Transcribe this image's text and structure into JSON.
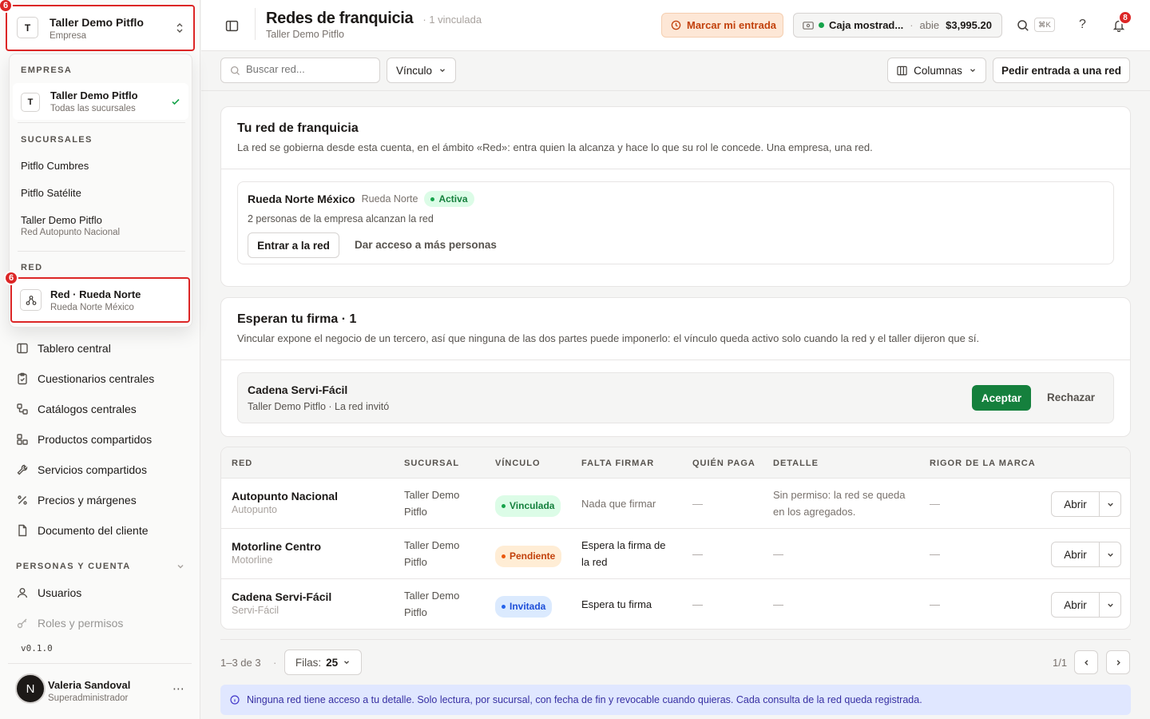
{
  "org_switcher": {
    "initial": "T",
    "name": "Taller Demo Pitflo",
    "subtitle": "Empresa",
    "badge": "6"
  },
  "dropdown": {
    "empresa_label": "EMPRESA",
    "empresa": {
      "initial": "T",
      "name": "Taller Demo Pitflo",
      "subtitle": "Todas las sucursales"
    },
    "sucursales_label": "SUCURSALES",
    "sucursales": [
      {
        "name": "Pitflo Cumbres",
        "subtitle": ""
      },
      {
        "name": "Pitflo Satélite",
        "subtitle": ""
      },
      {
        "name": "Taller Demo Pitflo",
        "subtitle": "Red Autopunto Nacional"
      }
    ],
    "red_label": "RED",
    "red": {
      "name": "Red · Rueda Norte",
      "subtitle": "Rueda Norte México",
      "badge": "6"
    }
  },
  "nav": {
    "items": [
      {
        "label": "Tablero central",
        "icon": "layout-icon"
      },
      {
        "label": "Cuestionarios centrales",
        "icon": "clipboard-icon"
      },
      {
        "label": "Catálogos centrales",
        "icon": "catalog-icon"
      },
      {
        "label": "Productos compartidos",
        "icon": "boxes-icon"
      },
      {
        "label": "Servicios compartidos",
        "icon": "wrench-icon"
      },
      {
        "label": "Precios y márgenes",
        "icon": "percent-icon"
      },
      {
        "label": "Documento del cliente",
        "icon": "document-icon"
      }
    ],
    "section_label": "PERSONAS Y CUENTA",
    "users": "Usuarios",
    "roles": "Roles y permisos",
    "version": "v0.1.0"
  },
  "user": {
    "initial": "N",
    "name": "Valeria Sandoval",
    "role": "Superadministrador"
  },
  "header": {
    "title": "Redes de franquicia",
    "count": "1 vinculada",
    "subtitle": "Taller Demo Pitflo",
    "checkin": "Marcar mi entrada",
    "register_name": "Caja mostrad...",
    "register_status": "abie",
    "register_amount": "$3,995.20",
    "shortcut": "⌘K",
    "help": "?",
    "notifications": "8"
  },
  "toolbar": {
    "search_placeholder": "Buscar red...",
    "vinculo": "Vínculo",
    "columnas": "Columnas",
    "request": "Pedir entrada a una red"
  },
  "own_network": {
    "title": "Tu red de franquicia",
    "description": "La red se gobierna desde esta cuenta, en el ámbito «Red»: entra quien la alcanza y hace lo que su rol le concede. Una empresa, una red.",
    "name": "Rueda Norte México",
    "short": "Rueda Norte",
    "status": "Activa",
    "reach": "2 personas de la empresa alcanzan la red",
    "enter": "Entrar a la red",
    "grant": "Dar acceso a más personas"
  },
  "pending": {
    "title": "Esperan tu firma · 1",
    "description": "Vincular expone el negocio de un tercero, así que ninguna de las dos partes puede imponerlo: el vínculo queda activo solo cuando la red y el taller dijeron que sí.",
    "name": "Cadena Servi-Fácil",
    "meta": "Taller Demo Pitflo · La red invitó",
    "accept": "Aceptar",
    "reject": "Rechazar"
  },
  "table": {
    "columns": [
      "RED",
      "SUCURSAL",
      "VÍNCULO",
      "FALTA FIRMAR",
      "QUIÉN PAGA",
      "DETALLE",
      "RIGOR DE LA MARCA"
    ],
    "open_label": "Abrir",
    "rows": [
      {
        "name": "Autopunto Nacional",
        "short": "Autopunto",
        "branch_1": "Taller Demo",
        "branch_2": "Pitflo",
        "status": "Vinculada",
        "missing_1": "Nada que firmar",
        "missing_2": "",
        "payer": "—",
        "detail_1": "Sin permiso: la red se queda",
        "detail_2": "en los agregados.",
        "rigor": "—"
      },
      {
        "name": "Motorline Centro",
        "short": "Motorline",
        "branch_1": "Taller Demo",
        "branch_2": "Pitflo",
        "status": "Pendiente",
        "missing_1": "Espera la firma de",
        "missing_2": "la red",
        "payer": "—",
        "detail_1": "—",
        "detail_2": "",
        "rigor": "—"
      },
      {
        "name": "Cadena Servi-Fácil",
        "short": "Servi-Fácil",
        "branch_1": "Taller Demo",
        "branch_2": "Pitflo",
        "status": "Invitada",
        "missing_1": "Espera tu firma",
        "missing_2": "",
        "payer": "—",
        "detail_1": "—",
        "detail_2": "",
        "rigor": "—"
      }
    ]
  },
  "pagination": {
    "range": "1–3 de 3",
    "rows_label": "Filas:",
    "rows_value": "25",
    "page": "1/1"
  },
  "info_banner": "Ninguna red tiene acceso a tu detalle. Solo lectura, por sucursal, con fecha de fin y revocable cuando quieras. Cada consulta de la red queda registrada.",
  "colors": {
    "accent_green": "#15803d",
    "highlight_red": "#dc2626",
    "checkin_bg": "#fde7d6"
  }
}
